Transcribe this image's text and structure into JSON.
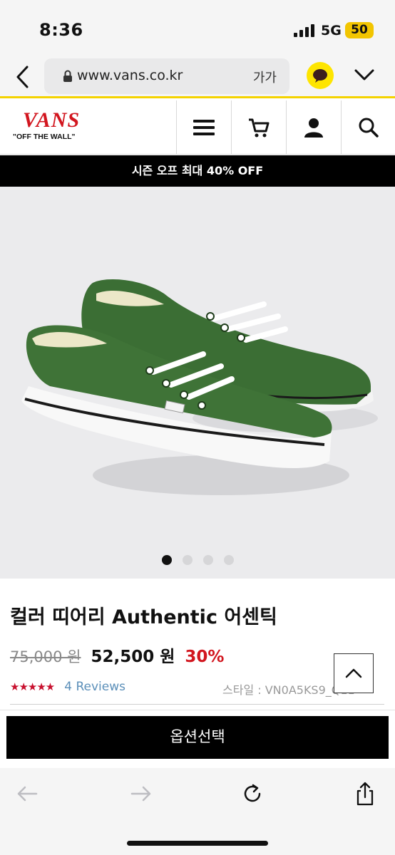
{
  "status_bar": {
    "time": "8:36",
    "network": "5G",
    "battery": "50"
  },
  "browser": {
    "url": "www.vans.co.kr",
    "text_size_label": "가가",
    "icons": [
      "back-icon",
      "lock-icon",
      "kakaotalk-icon",
      "chevron-down-icon"
    ]
  },
  "header": {
    "brand": "VANS",
    "slogan": "\"OFF THE WALL\"",
    "icons": [
      "menu-icon",
      "cart-icon",
      "user-icon",
      "search-icon"
    ]
  },
  "promo": {
    "text": "시즌 오프 최대 40% OFF"
  },
  "gallery": {
    "slide_count": 4,
    "active_index": 0
  },
  "product": {
    "title": "컬러 띠어리 Authentic 어센틱",
    "original_price": "75,000 원",
    "sale_price": "52,500 원",
    "discount": "30%",
    "rating_stars": "★★★★★",
    "reviews": "4 Reviews",
    "style_code": "스타일 : VN0A5KS9_Q11"
  },
  "option_button": {
    "label": "옵션선택"
  },
  "bottom_toolbar": {
    "icons": [
      "back-arrow-icon",
      "forward-arrow-icon",
      "reload-icon",
      "share-icon"
    ]
  },
  "colors": {
    "accent": "#d2161f",
    "kakao": "#fee500",
    "link": "#5b8fb9"
  }
}
